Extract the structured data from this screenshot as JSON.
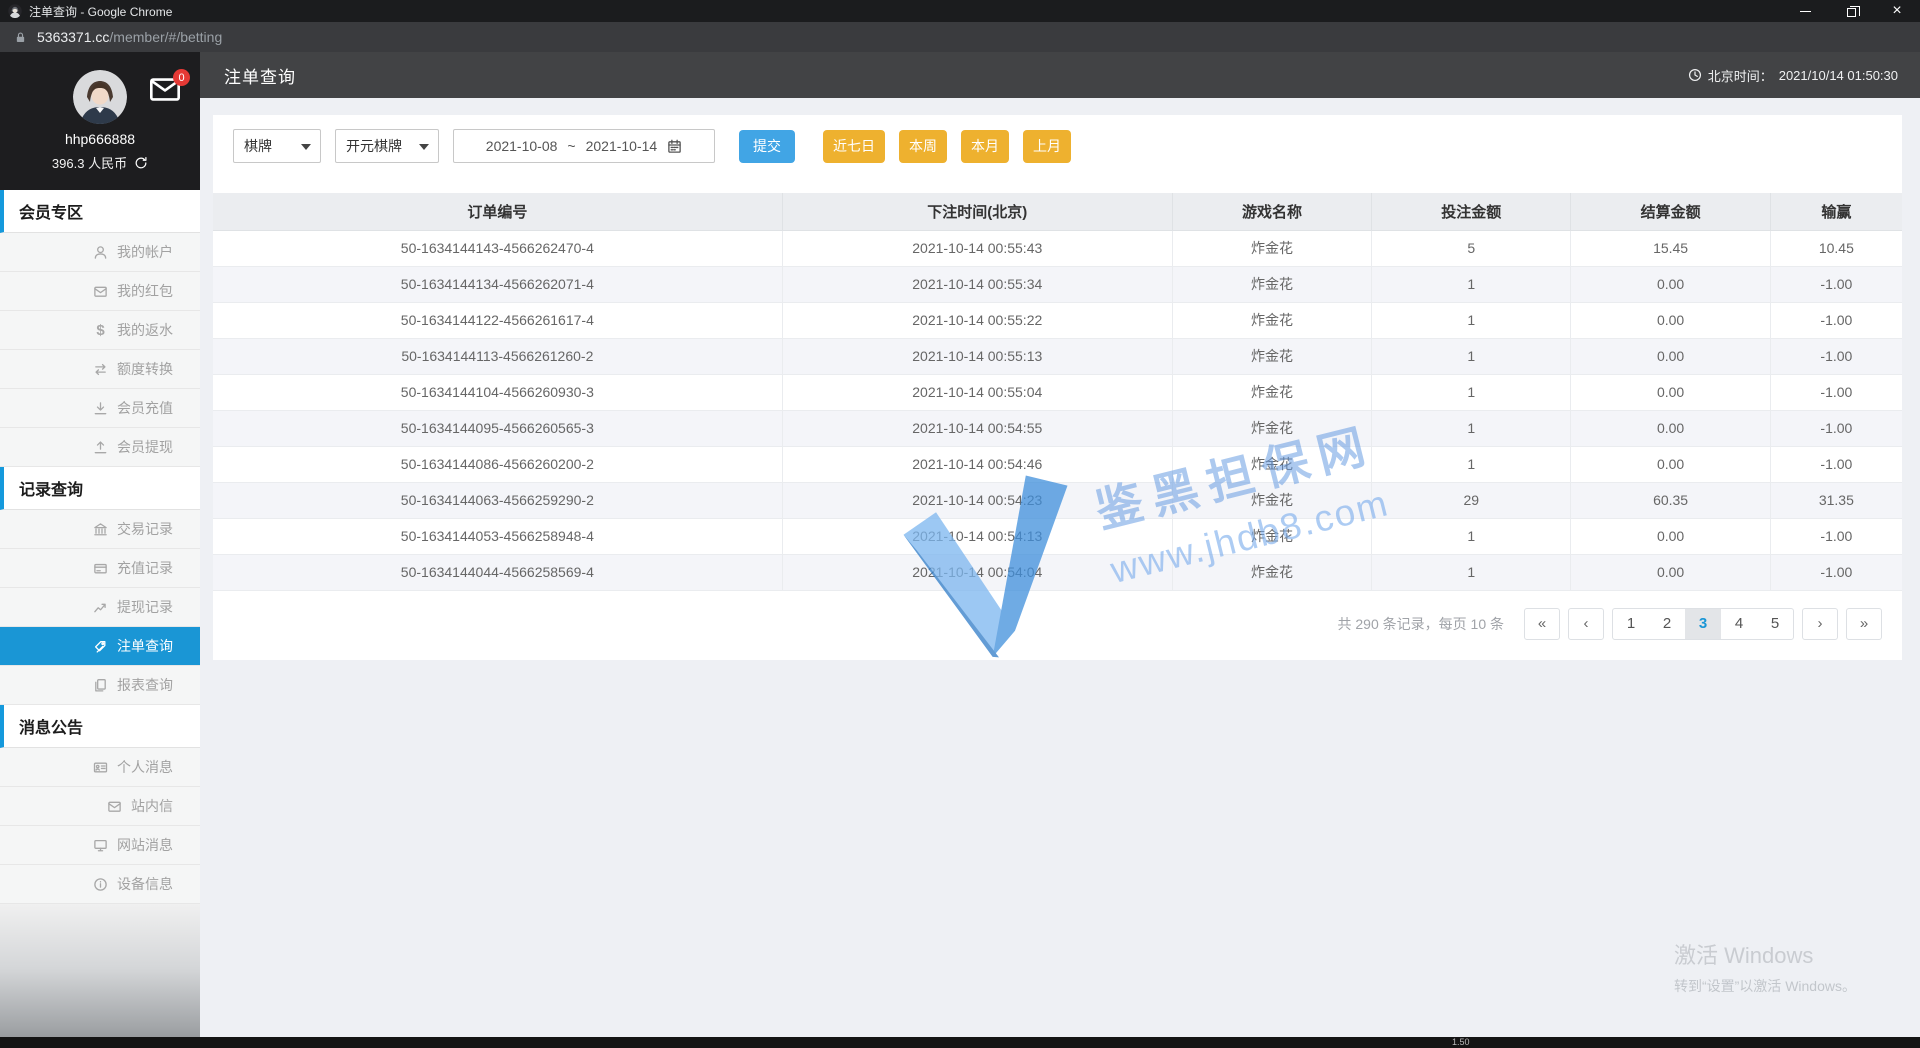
{
  "window": {
    "title": "注单查询 - Google Chrome",
    "url_main": "5363371.cc",
    "url_path": "/member/#/betting",
    "controls": {
      "minimize": "minimize-button",
      "restore": "restore-button",
      "close_glyph": "×"
    }
  },
  "header": {
    "title": "注单查询",
    "time_label": "北京时间：",
    "time_value": "2021/10/14 01:50:30"
  },
  "user": {
    "name": "hhp666888",
    "balance": "396.3 人民币",
    "mail_badge": "0"
  },
  "sidebar": {
    "sections": [
      {
        "title": "会员专区",
        "items": [
          {
            "icon": "user-icon",
            "label": "我的帐户"
          },
          {
            "icon": "red-packet-icon",
            "label": "我的红包"
          },
          {
            "icon": "dollar-icon",
            "label": "我的返水",
            "glyph": "$"
          },
          {
            "icon": "transfer-icon",
            "label": "额度转换"
          },
          {
            "icon": "deposit-icon",
            "label": "会员充值"
          },
          {
            "icon": "withdraw-icon",
            "label": "会员提现"
          }
        ]
      },
      {
        "title": "记录查询",
        "items": [
          {
            "icon": "bank-icon",
            "label": "交易记录"
          },
          {
            "icon": "card-icon",
            "label": "充值记录"
          },
          {
            "icon": "chart-icon",
            "label": "提现记录"
          },
          {
            "icon": "bet-tag-icon",
            "label": "注单查询",
            "active": true
          },
          {
            "icon": "report-icon",
            "label": "报表查询"
          }
        ]
      },
      {
        "title": "消息公告",
        "items": [
          {
            "icon": "idcard-icon",
            "label": "个人消息"
          },
          {
            "icon": "mail-icon",
            "label": "站内信"
          },
          {
            "icon": "monitor-icon",
            "label": "网站消息"
          },
          {
            "icon": "info-icon",
            "label": "设备信息"
          }
        ]
      }
    ]
  },
  "filters": {
    "category_select": {
      "value": "棋牌"
    },
    "provider_select": {
      "value": "开元棋牌"
    },
    "date_from": "2021-10-08",
    "date_separator": "~",
    "date_to": "2021-10-14",
    "submit_label": "提交",
    "quick_buttons": [
      "近七日",
      "本周",
      "本月",
      "上月"
    ]
  },
  "table": {
    "headers": [
      "订单编号",
      "下注时间(北京)",
      "游戏名称",
      "投注金额",
      "结算金额",
      "输赢"
    ],
    "rows": [
      [
        "50-1634144143-4566262470-4",
        "2021-10-14 00:55:43",
        "炸金花",
        "5",
        "15.45",
        "10.45"
      ],
      [
        "50-1634144134-4566262071-4",
        "2021-10-14 00:55:34",
        "炸金花",
        "1",
        "0.00",
        "-1.00"
      ],
      [
        "50-1634144122-4566261617-4",
        "2021-10-14 00:55:22",
        "炸金花",
        "1",
        "0.00",
        "-1.00"
      ],
      [
        "50-1634144113-4566261260-2",
        "2021-10-14 00:55:13",
        "炸金花",
        "1",
        "0.00",
        "-1.00"
      ],
      [
        "50-1634144104-4566260930-3",
        "2021-10-14 00:55:04",
        "炸金花",
        "1",
        "0.00",
        "-1.00"
      ],
      [
        "50-1634144095-4566260565-3",
        "2021-10-14 00:54:55",
        "炸金花",
        "1",
        "0.00",
        "-1.00"
      ],
      [
        "50-1634144086-4566260200-2",
        "2021-10-14 00:54:46",
        "炸金花",
        "1",
        "0.00",
        "-1.00"
      ],
      [
        "50-1634144063-4566259290-2",
        "2021-10-14 00:54:23",
        "炸金花",
        "29",
        "60.35",
        "31.35"
      ],
      [
        "50-1634144053-4566258948-4",
        "2021-10-14 00:54:13",
        "炸金花",
        "1",
        "0.00",
        "-1.00"
      ],
      [
        "50-1634144044-4566258569-4",
        "2021-10-14 00:54:04",
        "炸金花",
        "1",
        "0.00",
        "-1.00"
      ]
    ]
  },
  "pagination": {
    "summary": "共 290 条记录，每页 10 条",
    "first": "«",
    "prev": "‹",
    "pages": [
      "1",
      "2",
      "3",
      "4",
      "5"
    ],
    "active_page": "3",
    "next": "›",
    "last": "»"
  },
  "watermark": {
    "line1": "鉴黑担保网",
    "line2": "www.jhdb8.com"
  },
  "windows_activation": {
    "line1": "激活 Windows",
    "line2": "转到“设置”以激活 Windows。"
  },
  "bottom_bar": {
    "text": "1.50"
  },
  "colors": {
    "accent_blue": "#1a96d5",
    "submit_blue": "#41a5e5",
    "quick_yellow": "#eeb12f",
    "badge_red": "#e53935"
  }
}
